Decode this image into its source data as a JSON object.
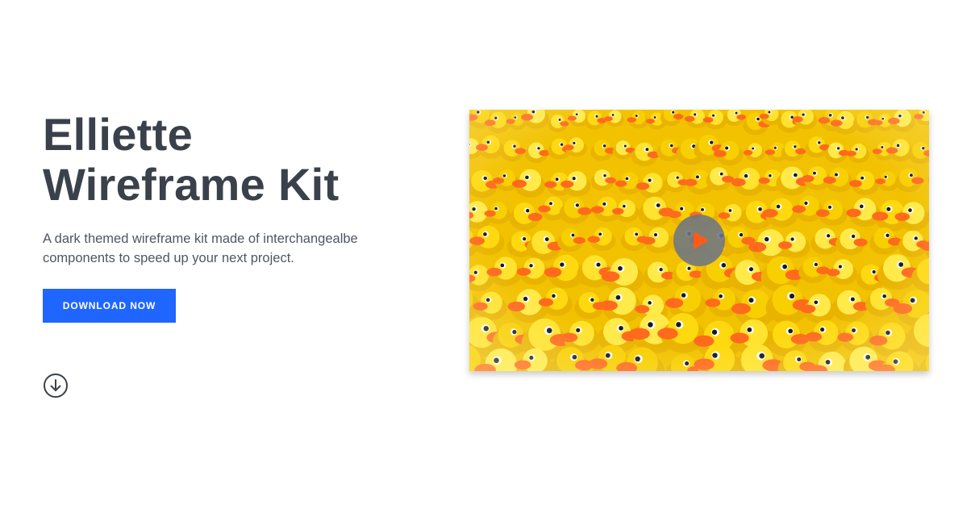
{
  "hero": {
    "title_line1": "Elliette",
    "title_line2": "Wireframe Kit",
    "description": "A dark themed wireframe kit made of interchangealbe components to speed up your next project.",
    "download_label": "DOWNLOAD NOW"
  },
  "icons": {
    "scroll": "arrow-down-circle-icon",
    "play": "play-icon"
  },
  "media": {
    "subject": "rubber ducks photo"
  },
  "colors": {
    "accent": "#1f66ff",
    "title": "#3a414b",
    "body_text": "#4f5662",
    "play_bg": "#6c7584",
    "play_triangle": "#ff5a1a"
  }
}
